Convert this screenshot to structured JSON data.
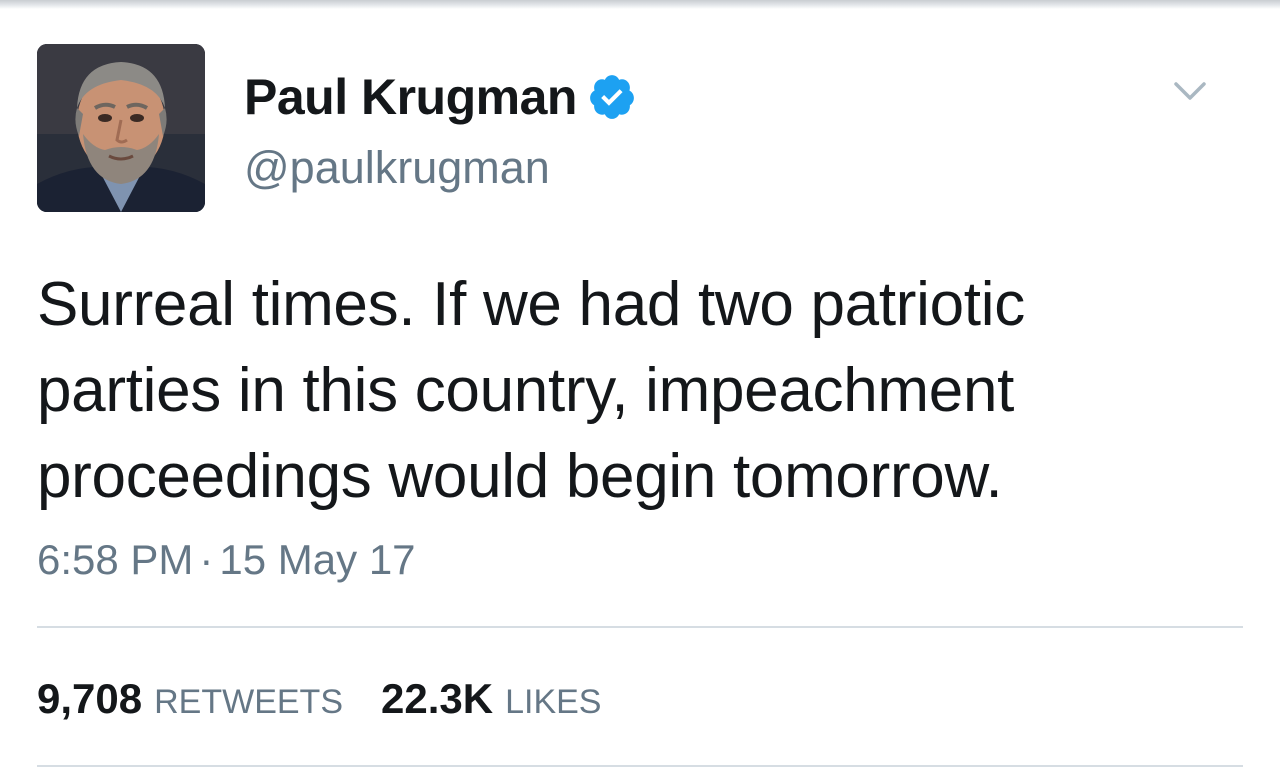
{
  "tweet": {
    "author": {
      "display_name": "Paul Krugman",
      "handle": "@paulkrugman",
      "verified": true,
      "verified_color": "#1da1f2"
    },
    "text_lines": [
      "Surreal times. If we had two patriotic",
      "parties in this country, impeachment",
      "proceedings would begin tomorrow."
    ],
    "time": "6:58 PM",
    "separator": "·",
    "date": "15 May 17",
    "stats": {
      "retweets_count": "9,708",
      "retweets_label": "RETWEETS",
      "likes_count": "22.3K",
      "likes_label": "LIKES"
    }
  },
  "icons": {
    "verified": "verified-badge-icon",
    "menu": "chevron-down-icon"
  },
  "colors": {
    "text_primary": "#14171a",
    "text_secondary": "#657786",
    "divider": "#d6dde3",
    "brand_blue": "#1da1f2"
  }
}
